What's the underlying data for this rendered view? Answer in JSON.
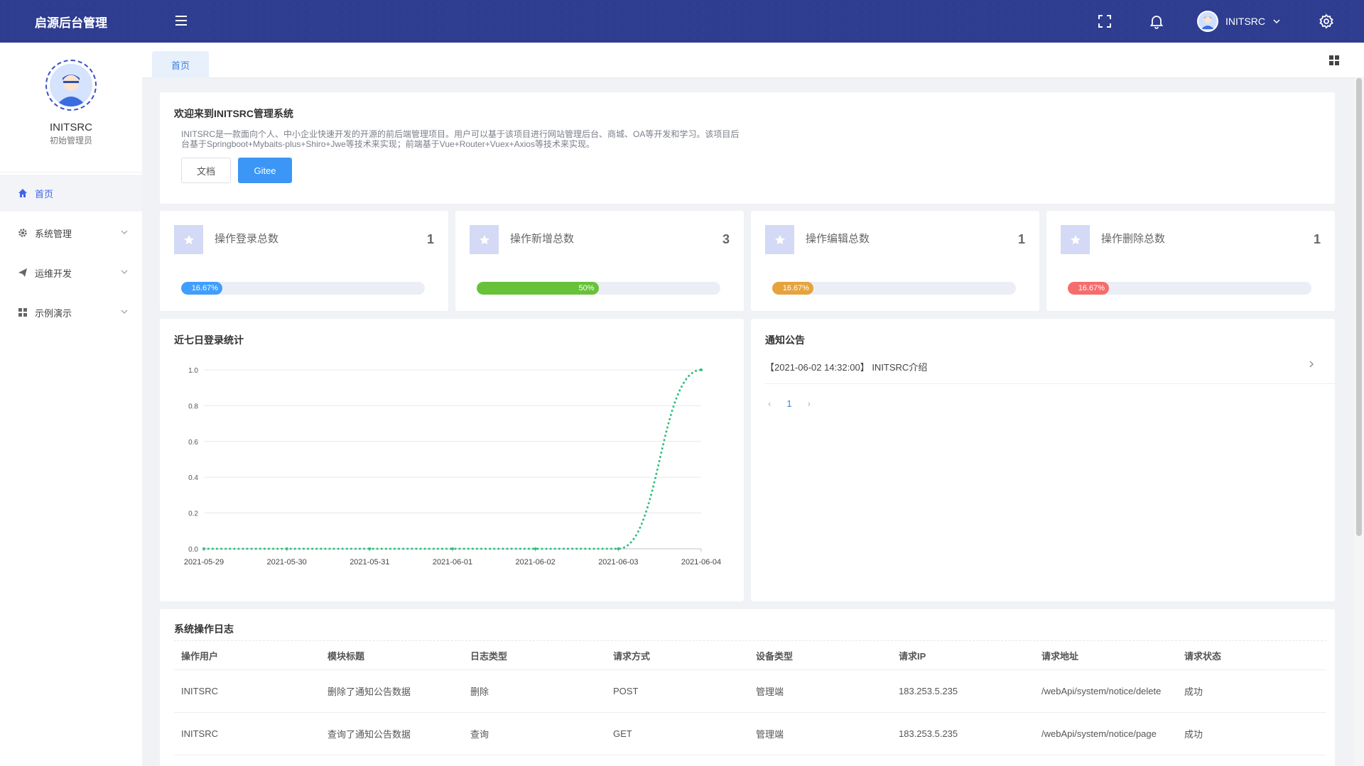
{
  "header": {
    "brand": "启源后台管理",
    "user_name": "INITSRC"
  },
  "sidebar": {
    "profile_name": "INITSRC",
    "profile_role": "初始管理员",
    "items": [
      {
        "label": "首页",
        "icon": "home-icon",
        "active": true
      },
      {
        "label": "系统管理",
        "icon": "gear-icon"
      },
      {
        "label": "运维开发",
        "icon": "send-icon"
      },
      {
        "label": "示例演示",
        "icon": "grid-icon"
      }
    ]
  },
  "tabs": {
    "home": "首页"
  },
  "welcome": {
    "title": "欢迎来到INITSRC管理系统",
    "text": "INITSRC是一款面向个人、中小企业快速开发的开源的前后端管理项目。用户可以基于该项目进行网站管理后台、商城、OA等开发和学习。该项目后台基于Springboot+Mybaits-plus+Shiro+Jwe等技术来实现；前端基于Vue+Router+Vuex+Axios等技术来实现。",
    "doc_button": "文档",
    "gitee_button": "Gitee"
  },
  "stats": [
    {
      "title": "操作登录总数",
      "value": "1",
      "percent_label": "16.67%",
      "percent": 16.67,
      "color": "#409eff"
    },
    {
      "title": "操作新增总数",
      "value": "3",
      "percent_label": "50%",
      "percent": 50,
      "color": "#67c23a"
    },
    {
      "title": "操作编辑总数",
      "value": "1",
      "percent_label": "16.67%",
      "percent": 16.67,
      "color": "#e6a23c"
    },
    {
      "title": "操作删除总数",
      "value": "1",
      "percent_label": "16.67%",
      "percent": 16.67,
      "color": "#f56c6c"
    }
  ],
  "login_chart": {
    "title": "近七日登录统计"
  },
  "chart_data": {
    "type": "line",
    "title": "近七日登录统计",
    "categories": [
      "2021-05-29",
      "2021-05-30",
      "2021-05-31",
      "2021-06-01",
      "2021-06-02",
      "2021-06-03",
      "2021-06-04"
    ],
    "values": [
      0,
      0,
      0,
      0,
      0,
      0,
      1
    ],
    "yticks": [
      "0.0",
      "0.2",
      "0.4",
      "0.6",
      "0.8",
      "1.0"
    ],
    "ylim": [
      0,
      1
    ],
    "color": "#2ec27e",
    "line_style": "dotted",
    "smooth": true,
    "grid": true
  },
  "notice": {
    "title": "通知公告",
    "items": [
      {
        "text": "【2021-06-02 14:32:00】 INITSRC介绍"
      }
    ],
    "page": "1"
  },
  "log_table": {
    "title": "系统操作日志",
    "columns": [
      "操作用户",
      "模块标题",
      "日志类型",
      "请求方式",
      "设备类型",
      "请求IP",
      "请求地址",
      "请求状态"
    ],
    "rows": [
      [
        "INITSRC",
        "删除了通知公告数据",
        "删除",
        "POST",
        "管理端",
        "183.253.5.235",
        "/webApi/system/notice/delete",
        "成功"
      ],
      [
        "INITSRC",
        "查询了通知公告数据",
        "查询",
        "GET",
        "管理端",
        "183.253.5.235",
        "/webApi/system/notice/page",
        "成功"
      ]
    ]
  }
}
